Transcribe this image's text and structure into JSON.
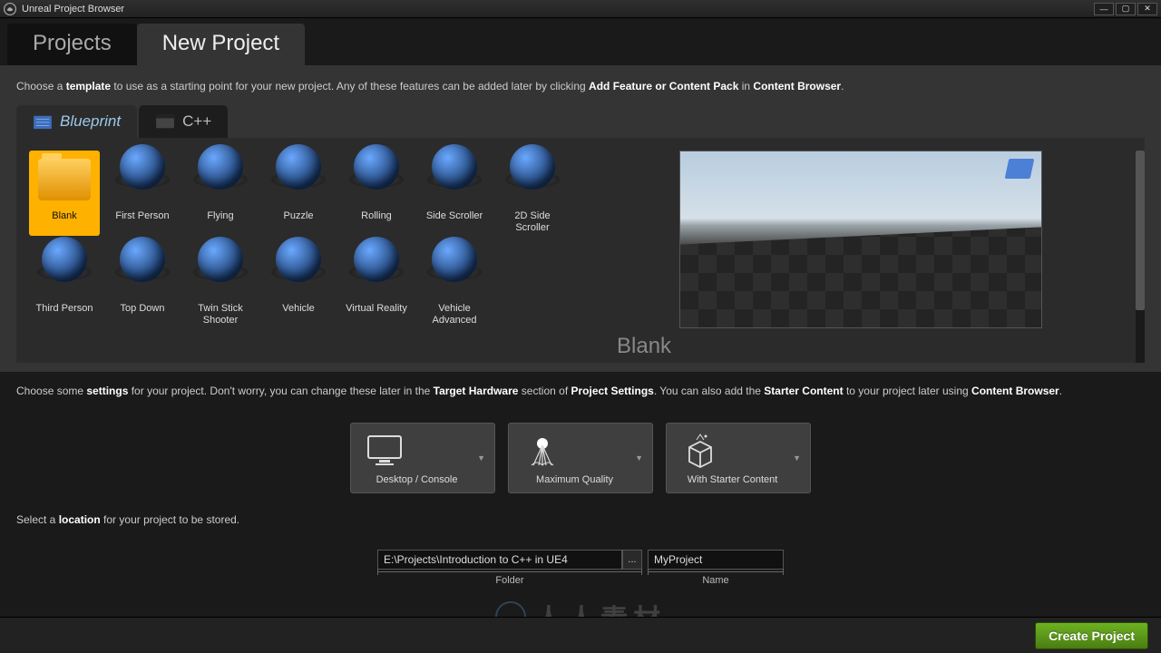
{
  "window": {
    "title": "Unreal Project Browser"
  },
  "mainTabs": [
    {
      "label": "Projects",
      "active": false
    },
    {
      "label": "New Project",
      "active": true
    }
  ],
  "desc1": {
    "pre": "Choose a ",
    "b1": "template",
    "mid": " to use as a starting point for your new project.  Any of these features can be added later by clicking ",
    "b2": "Add Feature or Content Pack",
    "mid2": " in ",
    "b3": "Content Browser",
    "end": "."
  },
  "subTabs": [
    {
      "label": "Blueprint",
      "active": true
    },
    {
      "label": "C++",
      "active": false
    }
  ],
  "templates": [
    {
      "label": "Blank",
      "selected": true,
      "icon": "folder"
    },
    {
      "label": "First Person",
      "icon": "generic"
    },
    {
      "label": "Flying",
      "icon": "generic"
    },
    {
      "label": "Puzzle",
      "icon": "generic"
    },
    {
      "label": "Rolling",
      "icon": "generic"
    },
    {
      "label": "Side Scroller",
      "icon": "generic"
    },
    {
      "label": "2D Side Scroller",
      "icon": "generic"
    },
    {
      "label": "Third Person",
      "icon": "generic"
    },
    {
      "label": "Top Down",
      "icon": "generic"
    },
    {
      "label": "Twin Stick Shooter",
      "icon": "generic"
    },
    {
      "label": "Vehicle",
      "icon": "generic"
    },
    {
      "label": "Virtual Reality",
      "icon": "generic"
    },
    {
      "label": "Vehicle Advanced",
      "icon": "generic"
    }
  ],
  "preview": {
    "label": "Blank"
  },
  "desc2": {
    "pre": "Choose some ",
    "b1": "settings",
    "mid1": " for your project.  Don't worry, you can change these later in the ",
    "b2": "Target Hardware",
    "mid2": " section of ",
    "b3": "Project Settings",
    "mid3": ".  You can also add the ",
    "b4": "Starter Content",
    "mid4": " to your project later using ",
    "b5": "Content Browser",
    "end": "."
  },
  "settings": [
    {
      "label": "Desktop / Console",
      "icon": "monitor"
    },
    {
      "label": "Maximum Quality",
      "icon": "quality"
    },
    {
      "label": "With Starter Content",
      "icon": "box"
    }
  ],
  "locationText": {
    "pre": "Select a ",
    "b": "location",
    "post": " for your project to be stored."
  },
  "folder": {
    "value": "E:\\Projects\\Introduction to C++ in UE4",
    "label": "Folder"
  },
  "name": {
    "value": "MyProject",
    "label": "Name"
  },
  "createBtn": "Create Project",
  "watermark": "人人素材"
}
